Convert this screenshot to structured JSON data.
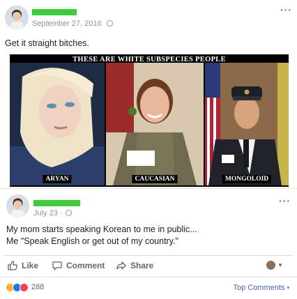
{
  "outer_post": {
    "timestamp": "September 27, 2016",
    "text": "Get it straight bitches.",
    "meme": {
      "title": "THESE ARE WHITE SUBSPECIES PEOPLE",
      "panels": [
        "ARYAN",
        "CAUCASIAN",
        "MONGOLOID"
      ]
    }
  },
  "inner_post": {
    "timestamp": "July 23",
    "text_line1": "My mom starts speaking Korean to me in public...",
    "text_line2": "Me \"Speak English or get out of my country.\""
  },
  "actions": {
    "like": "Like",
    "comment": "Comment",
    "share": "Share"
  },
  "footer": {
    "reaction_count": "288",
    "sort_label": "Top Comments"
  },
  "colors": {
    "redaction": "#3ecb3e",
    "like_blue": "#1877f2",
    "love_red": "#f33e58",
    "haha_yellow": "#f7b125"
  }
}
